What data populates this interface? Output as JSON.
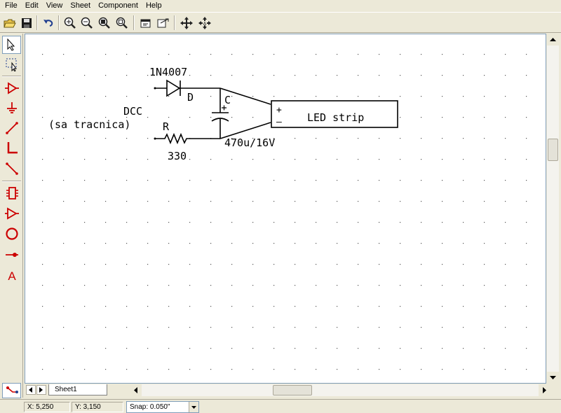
{
  "menu": [
    "File",
    "Edit",
    "View",
    "Sheet",
    "Component",
    "Help"
  ],
  "toolbar": {
    "buttons": [
      "open-icon",
      "save-icon",
      "undo-icon",
      "zoom-in-icon",
      "zoom-out-icon",
      "zoom-window-icon",
      "zoom-fit-icon",
      "properties-icon",
      "export-icon",
      "move-icon",
      "move-text-icon"
    ]
  },
  "toolbox": {
    "tools": [
      "select-icon",
      "select-area-icon",
      "component-icon",
      "ground-icon",
      "wire-icon",
      "bus-icon",
      "bus-entry-icon",
      "ic-icon",
      "triangle-icon",
      "circle-icon",
      "junction-icon",
      "text-icon"
    ]
  },
  "schematic": {
    "diode_ref": "D",
    "diode_value": "1N4007",
    "cap_ref": "C",
    "cap_value": "470u/16V",
    "res_ref": "R",
    "res_value": "330",
    "source_label_1": "DCC",
    "source_label_2": "(sa tracnica)",
    "plus_sign": "+",
    "minus_sign": "–",
    "load_label": "LED strip"
  },
  "sheet_tab": "Sheet1",
  "status": {
    "x": "X: 5,250",
    "y": "Y: 3,150",
    "snap": "Snap:  0.050\""
  },
  "colors": {
    "tool_red": "#cc0000",
    "canvas": "#ffffff",
    "chrome": "#ece9d8"
  }
}
